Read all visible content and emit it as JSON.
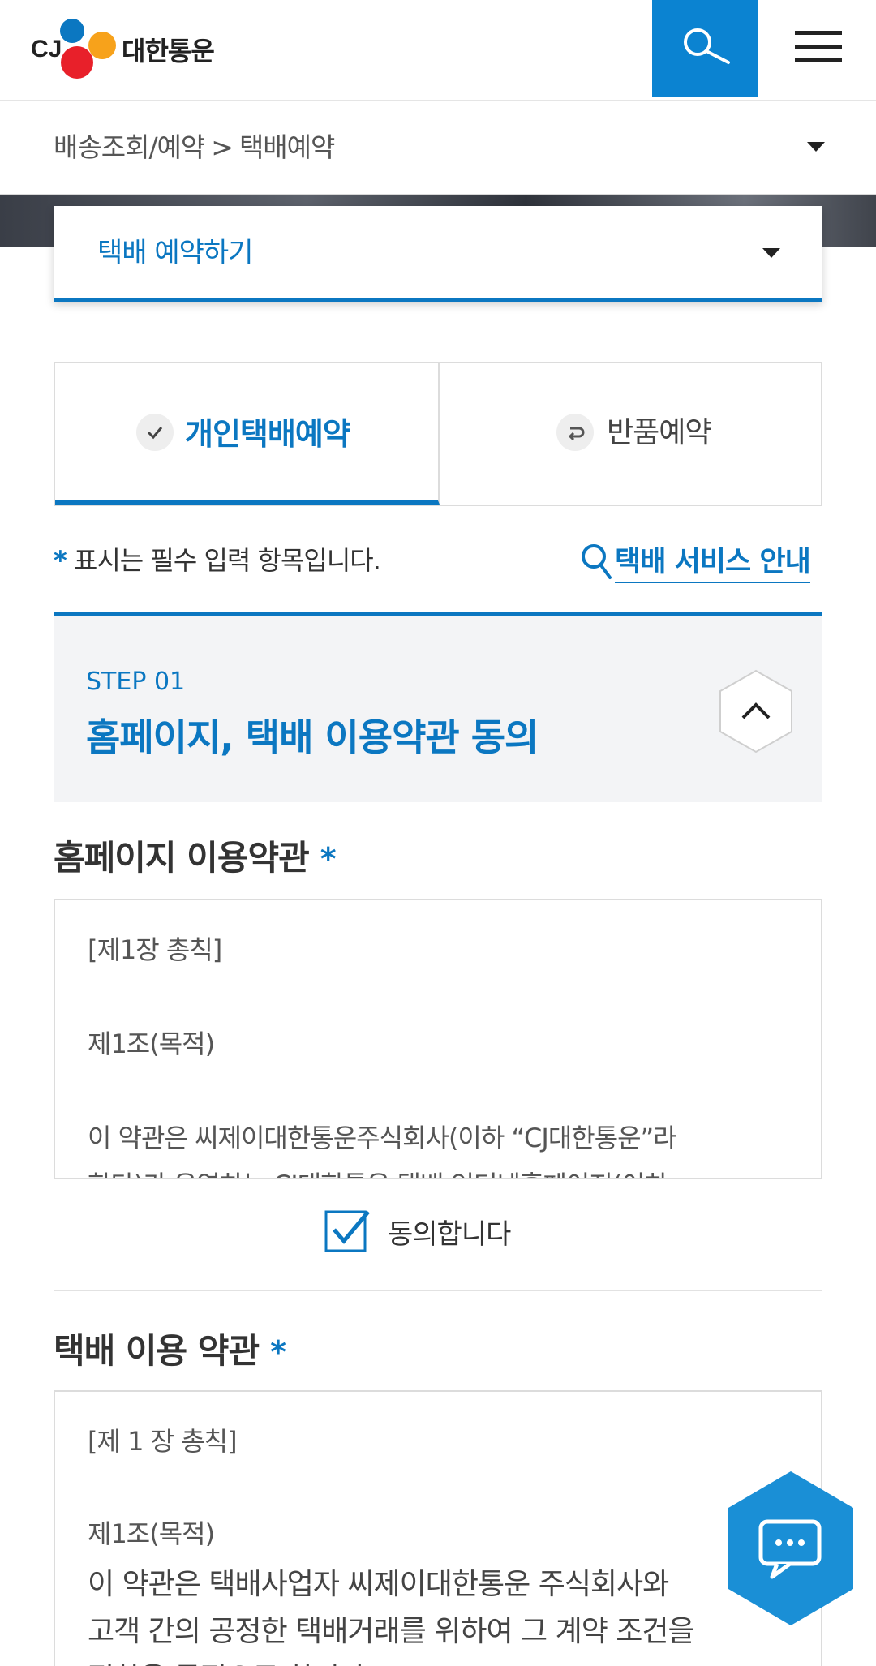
{
  "header": {
    "logo_text": "대한통운",
    "logo_cj": "CJ"
  },
  "breadcrumb": {
    "parent": "배송조회/예약",
    "separator": ">",
    "current": "택배예약"
  },
  "subselect": {
    "label": "택배 예약하기"
  },
  "tabs": [
    {
      "label": "개인택배예약",
      "active": true
    },
    {
      "label": "반품예약",
      "active": false
    }
  ],
  "required_note": {
    "star": "*",
    "text": "표시는 필수 입력 항목입니다."
  },
  "service_link": {
    "label": "택배 서비스 안내"
  },
  "step": {
    "number": "STEP 01",
    "title": "홈페이지, 택배 이용약관 동의"
  },
  "homepage_terms": {
    "title": "홈페이지 이용약관",
    "star": "*",
    "lines": [
      "[제1장 총칙]",
      "제1조(목적)",
      "이 약관은 씨제이대한통운주식회사(이하 “CJ대한통운”라",
      "한다)가 운영하는 CJ대한통운 택배 인터넷홈페이지(이하"
    ]
  },
  "agree": {
    "label": "동의합니다",
    "checked": true
  },
  "delivery_terms": {
    "title": "택배 이용 약관",
    "star": "*",
    "lines": [
      "[제 1 장 총칙]",
      "제1조(목적)",
      "이 약관은 택배사업자 씨제이대한통운 주식회사와",
      "고객 간의 공정한 택배거래를 위하여 그 계약 조건을",
      "정함을 목적으로 합니다."
    ]
  },
  "colors": {
    "brand_blue": "#0b77c1",
    "search_blue": "#0b83d1",
    "chat_blue": "#1a8fd6"
  }
}
